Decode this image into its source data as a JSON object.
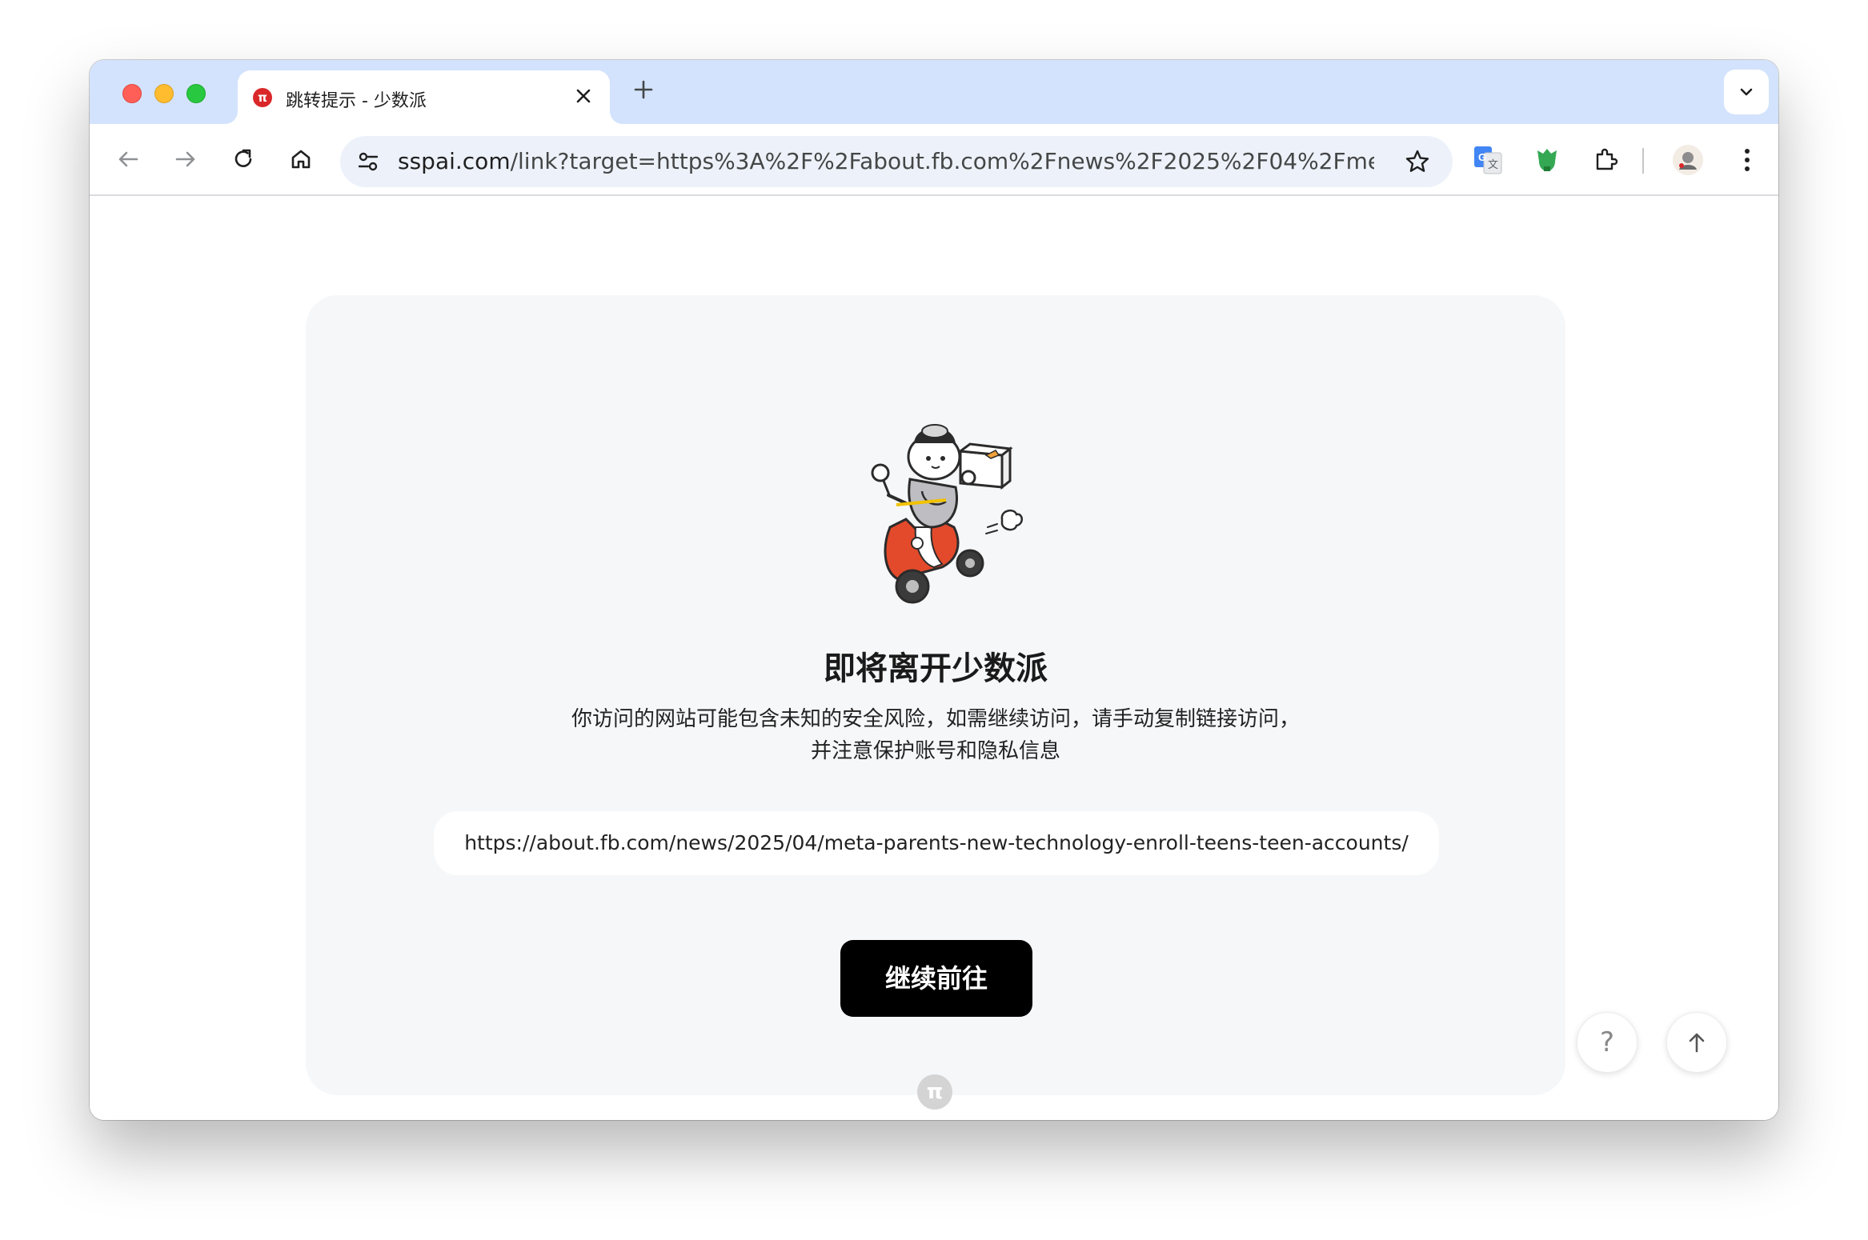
{
  "tab": {
    "favicon_text": "π",
    "title": "跳转提示 - 少数派",
    "close_glyph": "✕",
    "new_tab_glyph": "+"
  },
  "omnibox": {
    "host": "sspai.com",
    "path": "/link?target=https%3A%2F%2Fabout.fb.com%2Fnews%2F2025%2F04%2Fmet..."
  },
  "page": {
    "headline": "即将离开少数派",
    "description_line1": "你访问的网站可能包含未知的安全风险，如需继续访问，请手动复制链接访问，",
    "description_line2": "并注意保护账号和隐私信息",
    "target_url": "https://about.fb.com/news/2025/04/meta-parents-new-technology-enroll-teens-teen-accounts/",
    "continue_label": "继续前往",
    "help_glyph": "?",
    "footer_logo_text": "π"
  },
  "colors": {
    "tabstrip_bg": "#d3e3fd",
    "brand_red": "#da282a",
    "card_bg": "#f6f7f9",
    "button_bg": "#000000"
  }
}
